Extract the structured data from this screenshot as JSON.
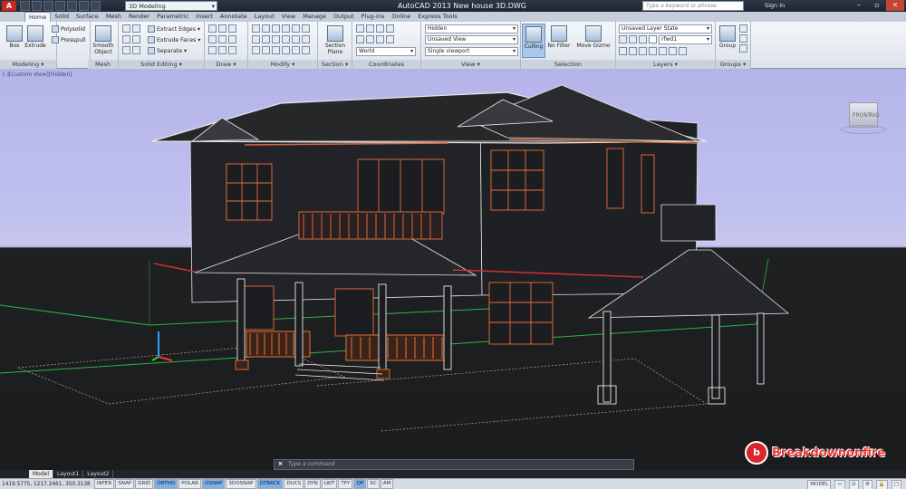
{
  "titlebar": {
    "app_logo": "A",
    "workspace": "3D Modeling",
    "title": "AutoCAD 2013    New house 3D.DWG",
    "search_placeholder": "Type a keyword or phrase",
    "sign_in": "Sign In"
  },
  "ribbon": {
    "tabs": [
      "Home",
      "Solid",
      "Surface",
      "Mesh",
      "Render",
      "Parametric",
      "Insert",
      "Annotate",
      "Layout",
      "View",
      "Manage",
      "Output",
      "Plug-ins",
      "Online",
      "Express Tools"
    ],
    "active_tab": "Home",
    "modeling": {
      "box": "Box",
      "extrude": "Extrude",
      "polysolid": "Polysolid",
      "presspull": "Presspull",
      "label": "Modeling ▾"
    },
    "mesh": {
      "smooth_object": "Smooth Object",
      "label": "Mesh"
    },
    "solid_editing": {
      "extract_edges": "Extract Edges ▾",
      "extrude_faces": "Extrude Faces ▾",
      "separate": "Separate ▾",
      "label": "Solid Editing ▾"
    },
    "draw": {
      "label": "Draw ▾"
    },
    "modify": {
      "label": "Modify ▾"
    },
    "section": {
      "section_plane": "Section Plane",
      "label": "Section ▾"
    },
    "coordinates": {
      "world": "World",
      "label": "Coordinates"
    },
    "view": {
      "visual_style": "Hidden",
      "saved_view": "Unsaved View",
      "viewport": "Single viewport",
      "label": "View ▾"
    },
    "selection": {
      "culling": "Culling",
      "no_filter": "No Filter",
      "move_gizmo": "Move Gizmo",
      "label": "Selection"
    },
    "layers": {
      "layer_state": "Unsaved Layer State",
      "layer": "rfwd1",
      "label": "Layers ▾"
    },
    "groups": {
      "group": "Group",
      "label": "Groups ▾"
    }
  },
  "viewport": {
    "label": "[-][Custom View][Hidden]",
    "viewcube_face": "FRONT",
    "viewcube_side": "RIG"
  },
  "command_line": {
    "close": "✖",
    "prompt": "Type a command"
  },
  "layout_tabs": [
    "Model",
    "Layout1",
    "Layout2"
  ],
  "statusbar": {
    "coords": "1419.5775, 1217.2461, 350.3138",
    "toggles": [
      {
        "label": "INFER",
        "on": false
      },
      {
        "label": "SNAP",
        "on": false
      },
      {
        "label": "GRID",
        "on": false
      },
      {
        "label": "ORTHO",
        "on": true
      },
      {
        "label": "POLAR",
        "on": false
      },
      {
        "label": "OSNAP",
        "on": true
      },
      {
        "label": "3DOSNAP",
        "on": false
      },
      {
        "label": "OTRACK",
        "on": true
      },
      {
        "label": "DUCS",
        "on": false
      },
      {
        "label": "DYN",
        "on": false
      },
      {
        "label": "LWT",
        "on": false
      },
      {
        "label": "TPY",
        "on": false
      },
      {
        "label": "QP",
        "on": true
      },
      {
        "label": "SC",
        "on": false
      },
      {
        "label": "AM",
        "on": false
      }
    ],
    "model": "MODEL"
  },
  "watermark": {
    "logo": "b",
    "text": "Breakdownonfire"
  },
  "colors": {
    "accent": "#7fb0e3",
    "drawing_orange": "#e8703a",
    "sky": "#c0c0ef",
    "ground": "#1b1c1e",
    "grid_green": "#2db34a"
  }
}
